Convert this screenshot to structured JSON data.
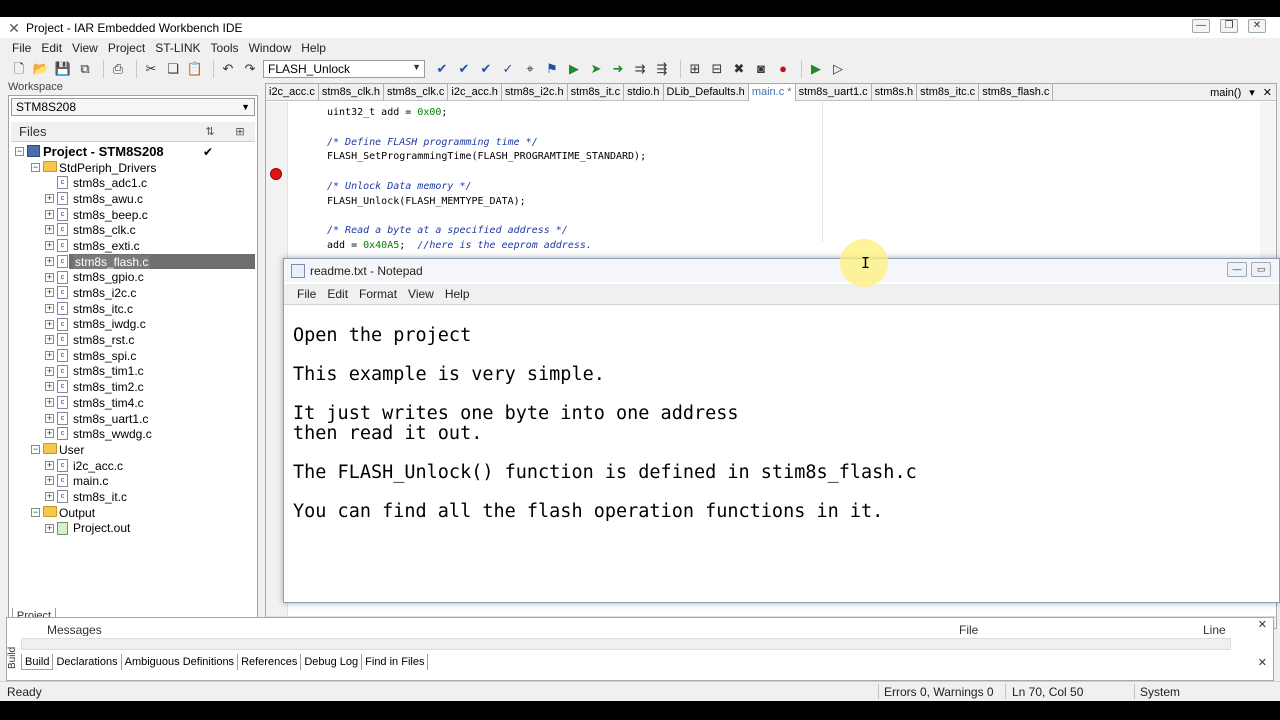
{
  "window": {
    "title": "Project - IAR Embedded Workbench IDE",
    "controls": {
      "minimize": "—",
      "maximize": "❐",
      "close": "✕"
    }
  },
  "menu": [
    "File",
    "Edit",
    "View",
    "Project",
    "ST-LINK",
    "Tools",
    "Window",
    "Help"
  ],
  "toolbar": {
    "find_combo_value": "FLASH_Unlock"
  },
  "workspace": {
    "label": "Workspace",
    "config": "STM8S208",
    "files_header": "Files",
    "project_name": "Project - STM8S208",
    "project_check": "✔",
    "groups": [
      {
        "name": "StdPeriph_Drivers",
        "files": [
          "stm8s_adc1.c",
          "stm8s_awu.c",
          "stm8s_beep.c",
          "stm8s_clk.c",
          "stm8s_exti.c",
          "stm8s_flash.c",
          "stm8s_gpio.c",
          "stm8s_i2c.c",
          "stm8s_itc.c",
          "stm8s_iwdg.c",
          "stm8s_rst.c",
          "stm8s_spi.c",
          "stm8s_tim1.c",
          "stm8s_tim2.c",
          "stm8s_tim4.c",
          "stm8s_uart1.c",
          "stm8s_wwdg.c"
        ]
      },
      {
        "name": "User",
        "files": [
          "i2c_acc.c",
          "main.c",
          "stm8s_it.c"
        ]
      },
      {
        "name": "Output",
        "files": [
          "Project.out"
        ]
      }
    ],
    "selected_file": "stm8s_flash.c",
    "bottom_tab": "Project"
  },
  "editor": {
    "tabs": [
      "i2c_acc.c",
      "stm8s_clk.h",
      "stm8s_clk.c",
      "i2c_acc.h",
      "stm8s_i2c.h",
      "stm8s_it.c",
      "stdio.h",
      "DLib_Defaults.h",
      "main.c *",
      "stm8s_uart1.c",
      "stm8s.h",
      "stm8s_itc.c",
      "stm8s_flash.c"
    ],
    "active_tab": "main.c *",
    "function_selector": "main()",
    "code": {
      "l1_a": "uint32_t add = ",
      "l1_num": "0x00",
      "l1_b": ";",
      "l2_comment": "/* Define FLASH programming time */",
      "l3": "FLASH_SetProgrammingTime(FLASH_PROGRAMTIME_STANDARD);",
      "l4_comment": "/* Unlock Data memory */",
      "l5": "FLASH_Unlock(FLASH_MEMTYPE_DATA);",
      "l6_comment": "/* Read a byte at a specified address */",
      "l7_a": "add = ",
      "l7_num": "0x40A5",
      "l7_b": ";  ",
      "l7_comment": "//here is the eeprom address."
    }
  },
  "notepad": {
    "title": "readme.txt - Notepad",
    "menu": [
      "File",
      "Edit",
      "Format",
      "View",
      "Help"
    ],
    "lines": [
      "Open the project",
      "",
      "This example is very simple.",
      "",
      "It just writes one byte into one address",
      "then read it out.",
      "",
      "The FLASH_Unlock() function is defined in stim8s_flash.c",
      "",
      "You can find all the flash operation functions in it."
    ]
  },
  "messages": {
    "col_messages": "Messages",
    "col_file": "File",
    "col_line": "Line",
    "side_label": "Build",
    "tabs": [
      "Build",
      "Declarations",
      "Ambiguous Definitions",
      "References",
      "Debug Log",
      "Find in Files"
    ],
    "active_tab": "Build"
  },
  "status": {
    "ready": "Ready",
    "errors": "Errors 0, Warnings 0",
    "position": "Ln 70, Col 50",
    "mode": "System"
  }
}
